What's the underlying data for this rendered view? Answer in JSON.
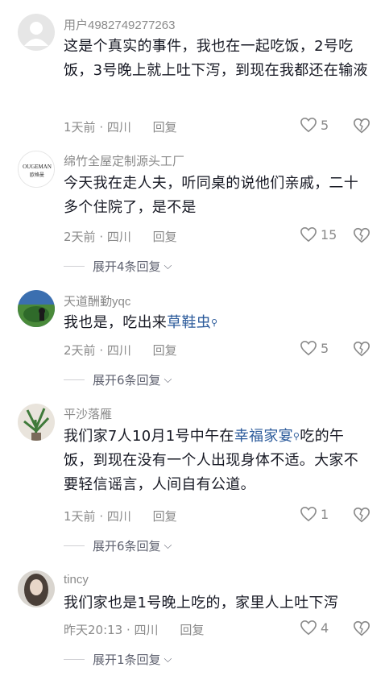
{
  "comments": [
    {
      "user": "用户4982749277263",
      "text_parts": [
        {
          "t": "这是个真实的事件，我也在一起吃饭，2号吃饭，3号晚上就上吐下泻，到现在我都还在输液"
        }
      ],
      "time": "1天前",
      "location": "四川",
      "reply_label": "回复",
      "likes": "5",
      "expand_label": ""
    },
    {
      "user": "绵竹全屋定制源头工厂",
      "avatar_text": "OUGEMAN 欧格曼",
      "text_parts": [
        {
          "t": "今天我在走人夫，听同桌的说他们亲戚，二十多个住院了，是不是"
        }
      ],
      "time": "2天前",
      "location": "四川",
      "reply_label": "回复",
      "likes": "15",
      "expand_label": "展开4条回复"
    },
    {
      "user": "天道酬勤yqc",
      "text_parts": [
        {
          "t": "我也是，吃出来"
        },
        {
          "t": "草鞋虫",
          "hl": true
        }
      ],
      "time": "2天前",
      "location": "四川",
      "reply_label": "回复",
      "likes": "5",
      "expand_label": "展开6条回复"
    },
    {
      "user": "平沙落雁",
      "text_parts": [
        {
          "t": "我们家7人10月1号中午在"
        },
        {
          "t": "幸福家宴",
          "hl": true
        },
        {
          "t": "吃的午饭，到现在没有一个人出现身体不适。大家不要轻信谣言，人间自有公道。"
        }
      ],
      "time": "1天前",
      "location": "四川",
      "reply_label": "回复",
      "likes": "1",
      "expand_label": "展开6条回复"
    },
    {
      "user": "tincy",
      "text_parts": [
        {
          "t": "我们家也是1号晚上吃的，家里人上吐下泻"
        }
      ],
      "time": "昨天20:13",
      "location": "四川",
      "reply_label": "回复",
      "likes": "4",
      "expand_label": "展开1条回复"
    }
  ],
  "separator": " · ",
  "search_glyph": "⚲"
}
